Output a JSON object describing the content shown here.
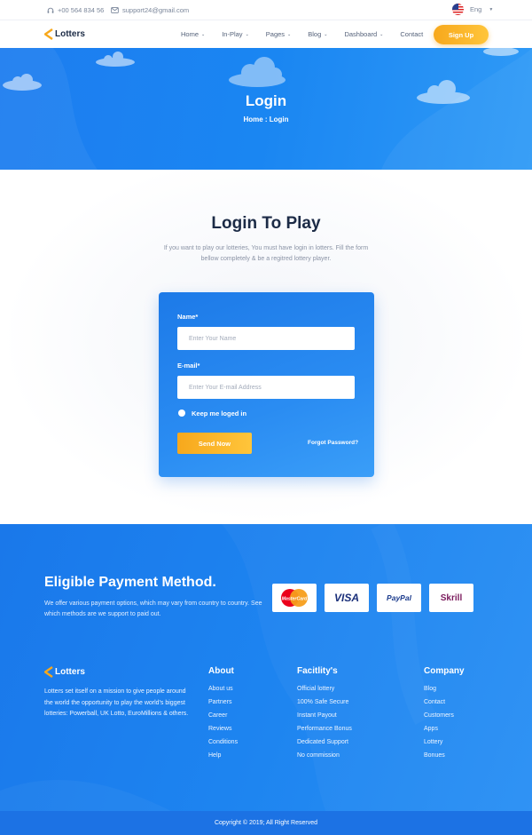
{
  "topbar": {
    "phone": "+00 564 834 56",
    "email": "support24@gmail.com",
    "language": "Eng"
  },
  "brand": {
    "name": "Lotters"
  },
  "nav": {
    "items": [
      {
        "label": "Home",
        "dropdown": true
      },
      {
        "label": "In-Play",
        "dropdown": true
      },
      {
        "label": "Pages",
        "dropdown": true
      },
      {
        "label": "Blog",
        "dropdown": true
      },
      {
        "label": "Dashboard",
        "dropdown": true
      },
      {
        "label": "Contact",
        "dropdown": false
      }
    ],
    "signup_label": "Sign Up"
  },
  "hero": {
    "title": "Login",
    "breadcrumb": "Home : Login"
  },
  "login": {
    "heading": "Login To Play",
    "intro": "If you want to play our lotteries, You must have login in lotters. Fill the form bellow completely & be a regitred lottery player.",
    "name_label": "Name*",
    "name_placeholder": "Enter Your Name",
    "email_label": "E-mail*",
    "email_placeholder": "Enter Your E-mail Address",
    "remember_label": "Keep me loged in",
    "submit_label": "Send Now",
    "forgot_label": "Forgot Password?"
  },
  "payment": {
    "title": "Eligible Payment Method.",
    "text": "We offer various payment options, which may vary from country to country. See which methods are we support to paid out.",
    "methods": [
      "MasterCard",
      "VISA",
      "PayPal",
      "Skrill"
    ]
  },
  "footer": {
    "about_text": "Lotters set itself on a mission to give people around the world the opportunity to play the world's biggest lotteries: Powerball, UK Lotto, EuroMillions & others.",
    "columns": [
      {
        "heading": "About",
        "links": [
          "About us",
          "Partners",
          "Career",
          "Reviews",
          "Conditions",
          "Help"
        ]
      },
      {
        "heading": "Facitlity's",
        "links": [
          "Official lottery",
          "100% Safe Secure",
          "Instant Payout",
          "Performance Bonus",
          "Dedicated Support",
          "No commission"
        ]
      },
      {
        "heading": "Company",
        "links": [
          "Blog",
          "Contact",
          "Customers",
          "Apps",
          "Lottery",
          "Bonues"
        ]
      }
    ],
    "copyright": "Copyright © 2019; All Right Reserved"
  },
  "colors": {
    "primary": "#1d7df0",
    "accent": "#f7a81c",
    "dark": "#1c2b46"
  }
}
